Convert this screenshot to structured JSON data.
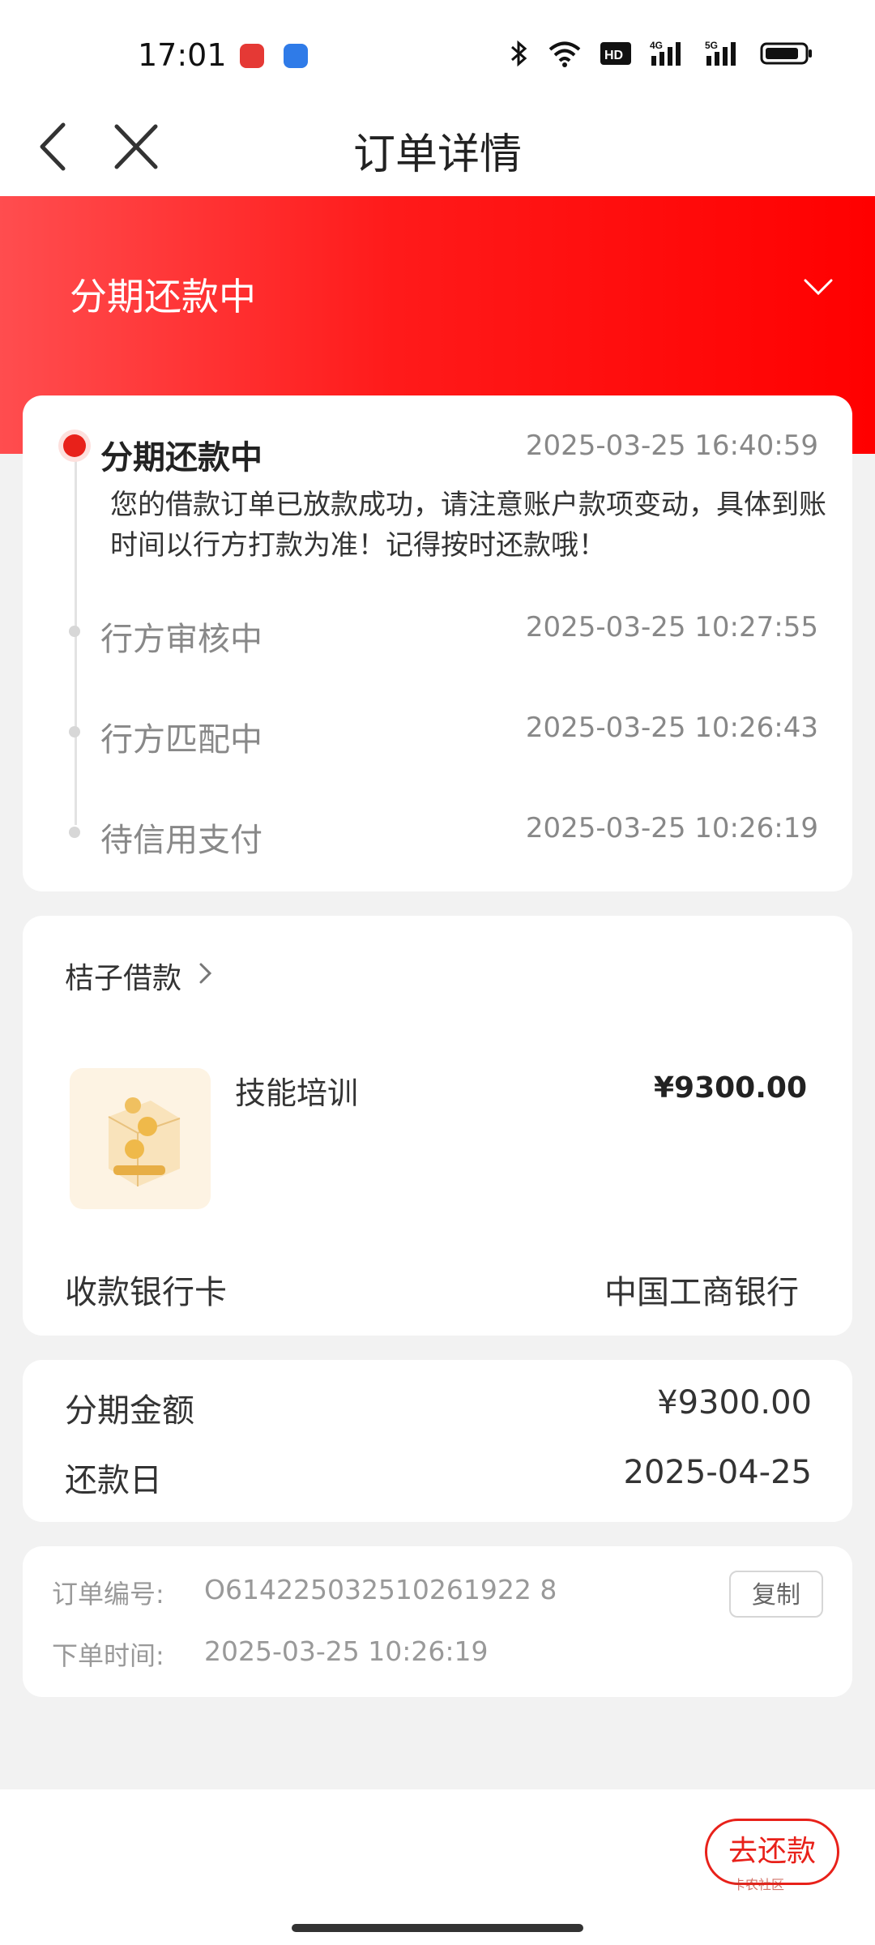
{
  "status_bar": {
    "time": "17:01",
    "app_icons": [
      "red-record-app-icon",
      "blue-app-icon"
    ],
    "system_icons": [
      "bluetooth-icon",
      "wifi-icon",
      "hd-icon",
      "4g-signal-icon",
      "5g-signal-icon",
      "battery-icon"
    ]
  },
  "nav": {
    "title": "订单详情",
    "back_icon": "chevron-left-icon",
    "close_icon": "close-icon"
  },
  "banner": {
    "status": "分期还款中",
    "expand_icon": "chevron-down-icon"
  },
  "timeline": {
    "items": [
      {
        "title": "分期还款中",
        "time": "2025-03-25 16:40:59",
        "active": true,
        "desc": "您的借款订单已放款成功，请注意账户款项变动，具体到账时间以行方打款为准！记得按时还款哦！"
      },
      {
        "title": "行方审核中",
        "time": "2025-03-25 10:27:55",
        "active": false
      },
      {
        "title": "行方匹配中",
        "time": "2025-03-25 10:26:43",
        "active": false
      },
      {
        "title": "待信用支付",
        "time": "2025-03-25 10:26:19",
        "active": false
      }
    ]
  },
  "merchant": {
    "name": "桔子借款",
    "product": {
      "name": "技能培训",
      "price": "¥9300.00",
      "image_icon": "coin-box-icon"
    },
    "bank_label": "收款银行卡",
    "bank_value": "中国工商银行"
  },
  "installment": {
    "amount_label": "分期金额",
    "amount_value": "¥9300.00",
    "due_label": "还款日",
    "due_value": "2025-04-25"
  },
  "order": {
    "number_label": "订单编号:",
    "number_value": "O614225032510261922 8",
    "time_label": "下单时间:",
    "time_value": "2025-03-25 10:26:19",
    "copy_label": "复制"
  },
  "bottom": {
    "repay_label": "去还款",
    "watermark": "卡农社区"
  },
  "colors": {
    "accent": "#e8211a",
    "banner_start": "#ff4d4f",
    "banner_end": "#ff0000",
    "background": "#f2f2f2"
  }
}
